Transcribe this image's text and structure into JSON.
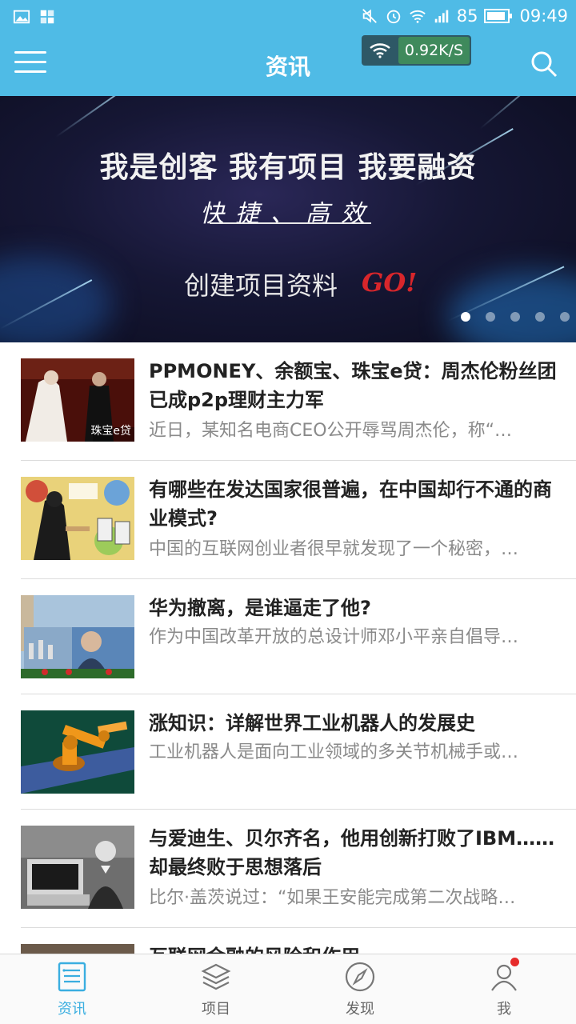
{
  "status_bar": {
    "battery": "85",
    "time": "09:49"
  },
  "app_bar": {
    "title": "资讯",
    "network_speed": "0.92K/S"
  },
  "banner": {
    "headline": "我是创客 我有项目 我要融资",
    "subtitle": "快捷、高效",
    "cta": "创建项目资料",
    "cta_badge": "GO!",
    "dot_count": 5,
    "active_dot": 0
  },
  "news": [
    {
      "title": "PPMONEY、余额宝、珠宝e贷：周杰伦粉丝团 已成p2p理财主力军",
      "summary": "近日，某知名电商CEO公开辱骂周杰伦，称“…",
      "thumb_caption": "珠宝e贷"
    },
    {
      "title": "有哪些在发达国家很普遍，在中国却行不通的商业模式?",
      "summary": "中国的互联网创业者很早就发现了一个秘密，…"
    },
    {
      "title": "华为撤离，是谁逼走了他?",
      "summary": "作为中国改革开放的总设计师邓小平亲自倡导…"
    },
    {
      "title": "涨知识：详解世界工业机器人的发展史",
      "summary": "工业机器人是面向工业领域的多关节机械手或…"
    },
    {
      "title": "与爱迪生、贝尔齐名，他用创新打败了IBM……却最终败于思想落后",
      "summary": "比尔·盖茨说过：“如果王安能完成第二次战略…"
    },
    {
      "title": "互联网金融的风险和作用",
      "summary": ""
    }
  ],
  "tabs": [
    {
      "label": "资讯",
      "icon": "news-icon",
      "active": true
    },
    {
      "label": "项目",
      "icon": "layers-icon",
      "active": false
    },
    {
      "label": "发现",
      "icon": "compass-icon",
      "active": false
    },
    {
      "label": "我",
      "icon": "person-icon",
      "active": false,
      "has_badge": true
    }
  ],
  "colors": {
    "accent": "#4fbbe6",
    "tab_active": "#3aaee0",
    "badge": "#e62b2b"
  }
}
